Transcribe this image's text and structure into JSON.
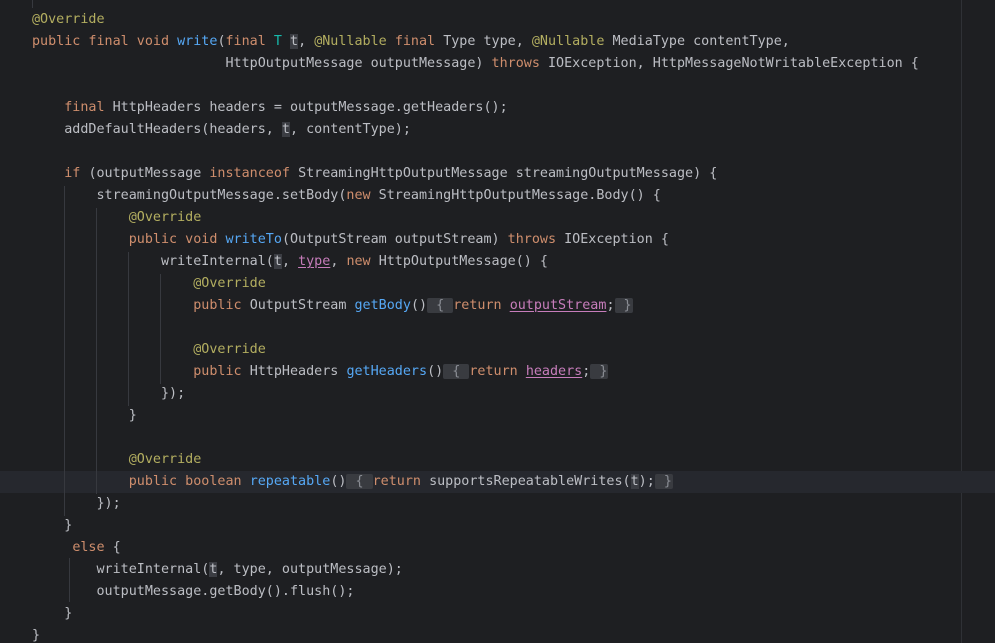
{
  "editor": {
    "lines": [
      {
        "id": "l01",
        "indent": "",
        "tokens": [
          [
            "ann",
            "@Override"
          ]
        ]
      },
      {
        "id": "l02",
        "indent": "",
        "tokens": [
          [
            "kw",
            "public final void "
          ],
          [
            "fn",
            "write"
          ],
          [
            "p",
            "("
          ],
          [
            "kw",
            "final "
          ],
          [
            "tp",
            "T "
          ],
          [
            "hl",
            "t"
          ],
          [
            "p",
            ", "
          ],
          [
            "ann",
            "@Nullable "
          ],
          [
            "kw",
            "final "
          ],
          [
            "p",
            "Type type, "
          ],
          [
            "ann",
            "@Nullable "
          ],
          [
            "p",
            "MediaType contentType,"
          ]
        ]
      },
      {
        "id": "l03",
        "indent": "                        ",
        "tokens": [
          [
            "p",
            "HttpOutputMessage outputMessage) "
          ],
          [
            "kw",
            "throws "
          ],
          [
            "p",
            "IOException, HttpMessageNotWritableException {"
          ]
        ]
      },
      {
        "id": "l04",
        "indent": "",
        "tokens": []
      },
      {
        "id": "l05",
        "indent": "    ",
        "tokens": [
          [
            "kw",
            "final "
          ],
          [
            "p",
            "HttpHeaders headers = outputMessage.getHeaders();"
          ]
        ]
      },
      {
        "id": "l06",
        "indent": "    ",
        "tokens": [
          [
            "p",
            "addDefaultHeaders(headers, "
          ],
          [
            "hl",
            "t"
          ],
          [
            "p",
            ", contentType);"
          ]
        ]
      },
      {
        "id": "l07",
        "indent": "",
        "tokens": []
      },
      {
        "id": "l08",
        "indent": "    ",
        "tokens": [
          [
            "kw",
            "if "
          ],
          [
            "p",
            "(outputMessage "
          ],
          [
            "kw",
            "instanceof "
          ],
          [
            "p",
            "StreamingHttpOutputMessage streamingOutputMessage) {"
          ]
        ]
      },
      {
        "id": "l09",
        "indent": "        ",
        "tokens": [
          [
            "p",
            "streamingOutputMessage.setBody("
          ],
          [
            "kw",
            "new "
          ],
          [
            "p",
            "StreamingHttpOutputMessage.Body() {"
          ]
        ]
      },
      {
        "id": "l10",
        "indent": "            ",
        "tokens": [
          [
            "ann",
            "@Override"
          ]
        ]
      },
      {
        "id": "l11",
        "indent": "            ",
        "tokens": [
          [
            "kw",
            "public void "
          ],
          [
            "fn",
            "writeTo"
          ],
          [
            "p",
            "(OutputStream outputStream) "
          ],
          [
            "kw",
            "throws "
          ],
          [
            "p",
            "IOException {"
          ]
        ]
      },
      {
        "id": "l12",
        "indent": "                ",
        "tokens": [
          [
            "p",
            "writeInternal("
          ],
          [
            "hl",
            "t"
          ],
          [
            "p",
            ", "
          ],
          [
            "ref",
            "type"
          ],
          [
            "p",
            ", "
          ],
          [
            "kw",
            "new "
          ],
          [
            "p",
            "HttpOutputMessage() {"
          ]
        ]
      },
      {
        "id": "l13",
        "indent": "                    ",
        "tokens": [
          [
            "ann",
            "@Override"
          ]
        ]
      },
      {
        "id": "l14",
        "indent": "                    ",
        "tokens": [
          [
            "kw",
            "public "
          ],
          [
            "p",
            "OutputStream "
          ],
          [
            "fn",
            "getBody"
          ],
          [
            "p",
            "()"
          ],
          [
            "fold",
            " { "
          ],
          [
            "kw",
            "return "
          ],
          [
            "ref",
            "outputStream"
          ],
          [
            "p",
            ";"
          ],
          [
            "fold",
            " }"
          ]
        ]
      },
      {
        "id": "l15",
        "indent": "",
        "tokens": []
      },
      {
        "id": "l16",
        "indent": "                    ",
        "tokens": [
          [
            "ann",
            "@Override"
          ]
        ]
      },
      {
        "id": "l17",
        "indent": "                    ",
        "tokens": [
          [
            "kw",
            "public "
          ],
          [
            "p",
            "HttpHeaders "
          ],
          [
            "fn",
            "getHeaders"
          ],
          [
            "p",
            "()"
          ],
          [
            "fold",
            " { "
          ],
          [
            "kw",
            "return "
          ],
          [
            "ref",
            "headers"
          ],
          [
            "p",
            ";"
          ],
          [
            "fold",
            " }"
          ]
        ]
      },
      {
        "id": "l18",
        "indent": "                ",
        "tokens": [
          [
            "p",
            "});"
          ]
        ]
      },
      {
        "id": "l19",
        "indent": "            ",
        "tokens": [
          [
            "p",
            "}"
          ]
        ]
      },
      {
        "id": "l20",
        "indent": "",
        "tokens": []
      },
      {
        "id": "l21",
        "indent": "            ",
        "tokens": [
          [
            "ann",
            "@Override"
          ]
        ]
      },
      {
        "id": "l22",
        "indent": "            ",
        "tokens": [
          [
            "kw",
            "public boolean "
          ],
          [
            "fn",
            "repeatable"
          ],
          [
            "p",
            "()"
          ],
          [
            "fold",
            " { "
          ],
          [
            "kw",
            "return "
          ],
          [
            "p",
            "supportsRepeatableWrites("
          ],
          [
            "hl",
            "t"
          ],
          [
            "p",
            ");"
          ],
          [
            "fold",
            " }"
          ]
        ]
      },
      {
        "id": "l23",
        "indent": "        ",
        "tokens": [
          [
            "p",
            "});"
          ]
        ]
      },
      {
        "id": "l24",
        "indent": "    ",
        "tokens": [
          [
            "p",
            "}"
          ]
        ]
      },
      {
        "id": "l25",
        "indent": "     ",
        "tokens": [
          [
            "kw",
            "else "
          ],
          [
            "p",
            "{"
          ]
        ]
      },
      {
        "id": "l26",
        "indent": "        ",
        "tokens": [
          [
            "p",
            "writeInternal("
          ],
          [
            "hl",
            "t"
          ],
          [
            "p",
            ", type, outputMessage);"
          ]
        ]
      },
      {
        "id": "l27",
        "indent": "        ",
        "tokens": [
          [
            "p",
            "outputMessage.getBody().flush();"
          ]
        ]
      },
      {
        "id": "l28",
        "indent": "    ",
        "tokens": [
          [
            "p",
            "}"
          ]
        ]
      },
      {
        "id": "l29",
        "indent": "",
        "tokens": [
          [
            "p",
            "}"
          ]
        ]
      }
    ]
  },
  "colors": {
    "background": "#1e1f22",
    "keyword": "#cf8e6d",
    "annotation": "#b3ae60",
    "method": "#56a8f5",
    "type_param": "#16baac",
    "field_ref": "#c77dbb",
    "text": "#bcbec4"
  }
}
